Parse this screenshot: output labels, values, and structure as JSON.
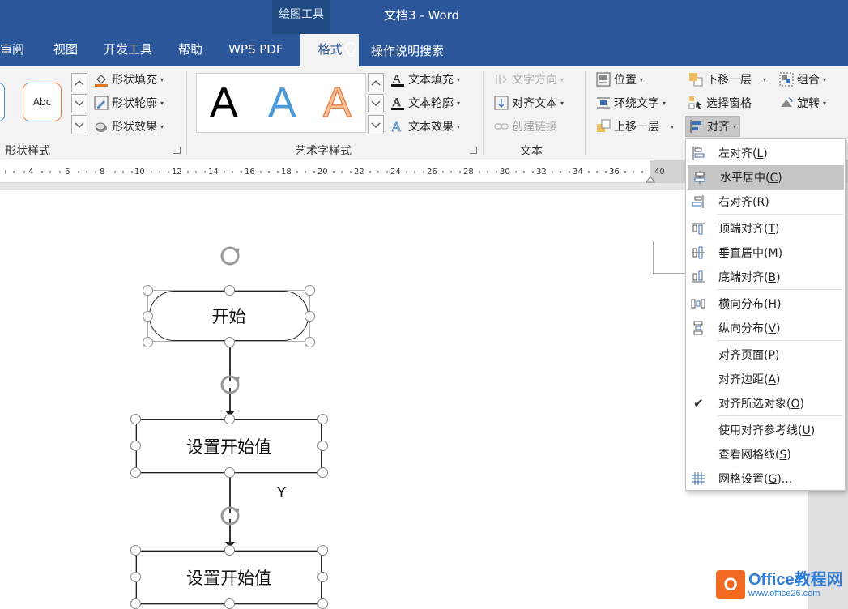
{
  "window": {
    "context_tab_group": "绘图工具",
    "document_title": "文档3  -  Word"
  },
  "tabs": [
    {
      "label": "审阅"
    },
    {
      "label": "视图"
    },
    {
      "label": "开发工具"
    },
    {
      "label": "帮助"
    },
    {
      "label": "WPS PDF"
    },
    {
      "label": "格式"
    }
  ],
  "tell_me": {
    "label": "操作说明搜索",
    "icon": "lightbulb-icon"
  },
  "ribbon": {
    "shape_styles": {
      "gallery_sample": "Abc",
      "fill": "形状填充",
      "outline": "形状轮廓",
      "effects": "形状效果",
      "label": "形状样式"
    },
    "wordart_styles": {
      "samples": [
        "A",
        "A",
        "A"
      ],
      "text_fill": "文本填充",
      "text_outline": "文本轮廓",
      "text_effects": "文本效果",
      "label": "艺术字样式"
    },
    "text": {
      "direction": "文字方向",
      "align_text": "对齐文本",
      "create_link": "创建链接",
      "label": "文本"
    },
    "arrange": {
      "position": "位置",
      "wrap_text": "环绕文字",
      "bring_forward": "上移一层",
      "send_backward": "下移一层",
      "selection_pane": "选择窗格",
      "align": "对齐",
      "group": "组合",
      "rotate": "旋转"
    }
  },
  "ruler": {
    "numbers": [
      "4",
      "6",
      "8",
      "10",
      "12",
      "14",
      "16",
      "18",
      "20",
      "22",
      "24",
      "26",
      "28",
      "30",
      "32",
      "34",
      "36",
      "38",
      "40"
    ]
  },
  "document": {
    "shapes": [
      {
        "text": "开始"
      },
      {
        "text": "设置开始值"
      },
      {
        "text": "设置开始值"
      }
    ],
    "y_label": "Y"
  },
  "align_menu": {
    "items": [
      {
        "label": "左对齐(",
        "key": "L",
        "end": ")",
        "icon": "align-left-icon"
      },
      {
        "label": "水平居中(",
        "key": "C",
        "end": ")",
        "icon": "align-center-icon",
        "highlighted": true
      },
      {
        "label": "右对齐(",
        "key": "R",
        "end": ")",
        "icon": "align-right-icon"
      },
      {
        "label": "顶端对齐(",
        "key": "T",
        "end": ")",
        "icon": "align-top-icon"
      },
      {
        "label": "垂直居中(",
        "key": "M",
        "end": ")",
        "icon": "align-middle-icon"
      },
      {
        "label": "底端对齐(",
        "key": "B",
        "end": ")",
        "icon": "align-bottom-icon"
      },
      {
        "label": "横向分布(",
        "key": "H",
        "end": ")",
        "icon": "distribute-horizontal-icon"
      },
      {
        "label": "纵向分布(",
        "key": "V",
        "end": ")",
        "icon": "distribute-vertical-icon"
      },
      {
        "label": "对齐页面(",
        "key": "P",
        "end": ")"
      },
      {
        "label": "对齐边距(",
        "key": "A",
        "end": ")"
      },
      {
        "label": "对齐所选对象(",
        "key": "O",
        "end": ")",
        "checked": true
      },
      {
        "label": "使用对齐参考线(",
        "key": "U",
        "end": ")"
      },
      {
        "label": "查看网格线(",
        "key": "S",
        "end": ")"
      },
      {
        "label": "网格设置(",
        "key": "G",
        "end": ")...",
        "icon": "grid-icon"
      }
    ]
  },
  "watermark": {
    "title": "Office教程网",
    "url": "www.office26.com"
  }
}
